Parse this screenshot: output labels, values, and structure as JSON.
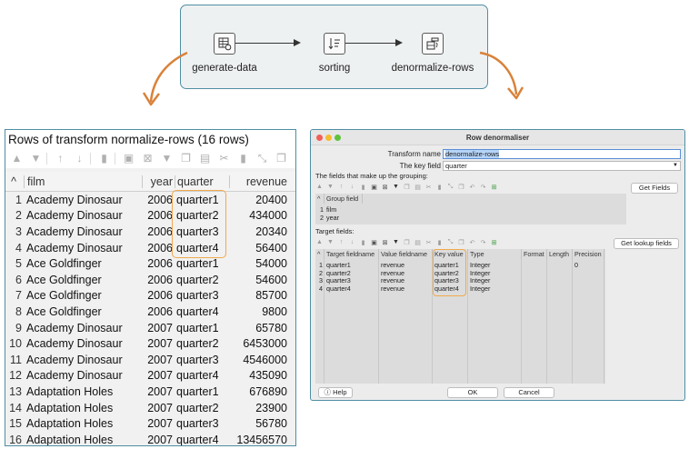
{
  "pipeline": {
    "steps": [
      {
        "label": "generate-data",
        "icon": "table-gear-icon"
      },
      {
        "label": "sorting",
        "icon": "sort-icon"
      },
      {
        "label": "denormalize-rows",
        "icon": "denormalize-icon"
      }
    ]
  },
  "rows_panel": {
    "title": "Rows of transform normalize-rows (16 rows)",
    "columns": [
      "film",
      "year",
      "quarter",
      "revenue"
    ],
    "rows": [
      [
        "1",
        "Academy Dinosaur",
        "2006",
        "quarter1",
        "20400"
      ],
      [
        "2",
        "Academy Dinosaur",
        "2006",
        "quarter2",
        "434000"
      ],
      [
        "3",
        "Academy Dinosaur",
        "2006",
        "quarter3",
        "20340"
      ],
      [
        "4",
        "Academy Dinosaur",
        "2006",
        "quarter4",
        "56400"
      ],
      [
        "5",
        "Ace Goldfinger",
        "2006",
        "quarter1",
        "54000"
      ],
      [
        "6",
        "Ace Goldfinger",
        "2006",
        "quarter2",
        "54600"
      ],
      [
        "7",
        "Ace Goldfinger",
        "2006",
        "quarter3",
        "85700"
      ],
      [
        "8",
        "Ace Goldfinger",
        "2006",
        "quarter4",
        "9800"
      ],
      [
        "9",
        "Academy Dinosaur",
        "2007",
        "quarter1",
        "65780"
      ],
      [
        "10",
        "Academy Dinosaur",
        "2007",
        "quarter2",
        "6453000"
      ],
      [
        "11",
        "Academy Dinosaur",
        "2007",
        "quarter3",
        "4546000"
      ],
      [
        "12",
        "Academy Dinosaur",
        "2007",
        "quarter4",
        "435090"
      ],
      [
        "13",
        "Adaptation Holes",
        "2007",
        "quarter1",
        "676890"
      ],
      [
        "14",
        "Adaptation Holes",
        "2007",
        "quarter2",
        "23900"
      ],
      [
        "15",
        "Adaptation Holes",
        "2007",
        "quarter3",
        "56780"
      ],
      [
        "16",
        "Adaptation Holes",
        "2007",
        "quarter4",
        "13456570"
      ]
    ]
  },
  "dialog": {
    "title": "Row denormaliser",
    "transform_name_label": "Transform name",
    "transform_name_value": "denormalize-rows",
    "key_field_label": "The key field",
    "key_field_value": "quarter",
    "grouping_label": "The fields that make up the grouping:",
    "group_table": {
      "header": "Group field",
      "rows": [
        [
          "1",
          "film"
        ],
        [
          "2",
          "year"
        ]
      ]
    },
    "get_fields_button": "Get Fields",
    "target_label": "Target fields:",
    "get_lookup_button": "Get lookup fields",
    "target_table": {
      "headers": [
        "Target fieldname",
        "Value fieldname",
        "Key value",
        "Type",
        "Format",
        "Length",
        "Precision"
      ],
      "rows": [
        [
          "1",
          "quarter1",
          "revenue",
          "quarter1",
          "Integer",
          "",
          "",
          "0"
        ],
        [
          "2",
          "quarter2",
          "revenue",
          "quarter2",
          "Integer",
          "",
          "",
          ""
        ],
        [
          "3",
          "quarter3",
          "revenue",
          "quarter3",
          "Integer",
          "",
          "",
          ""
        ],
        [
          "4",
          "quarter4",
          "revenue",
          "quarter4",
          "Integer",
          "",
          "",
          ""
        ]
      ]
    },
    "help_button": "Help",
    "ok_button": "OK",
    "cancel_button": "Cancel"
  },
  "colors": {
    "accent_border": "#4f8ea3",
    "highlight": "#f0a94d",
    "curve_arrow": "#d9823a"
  }
}
